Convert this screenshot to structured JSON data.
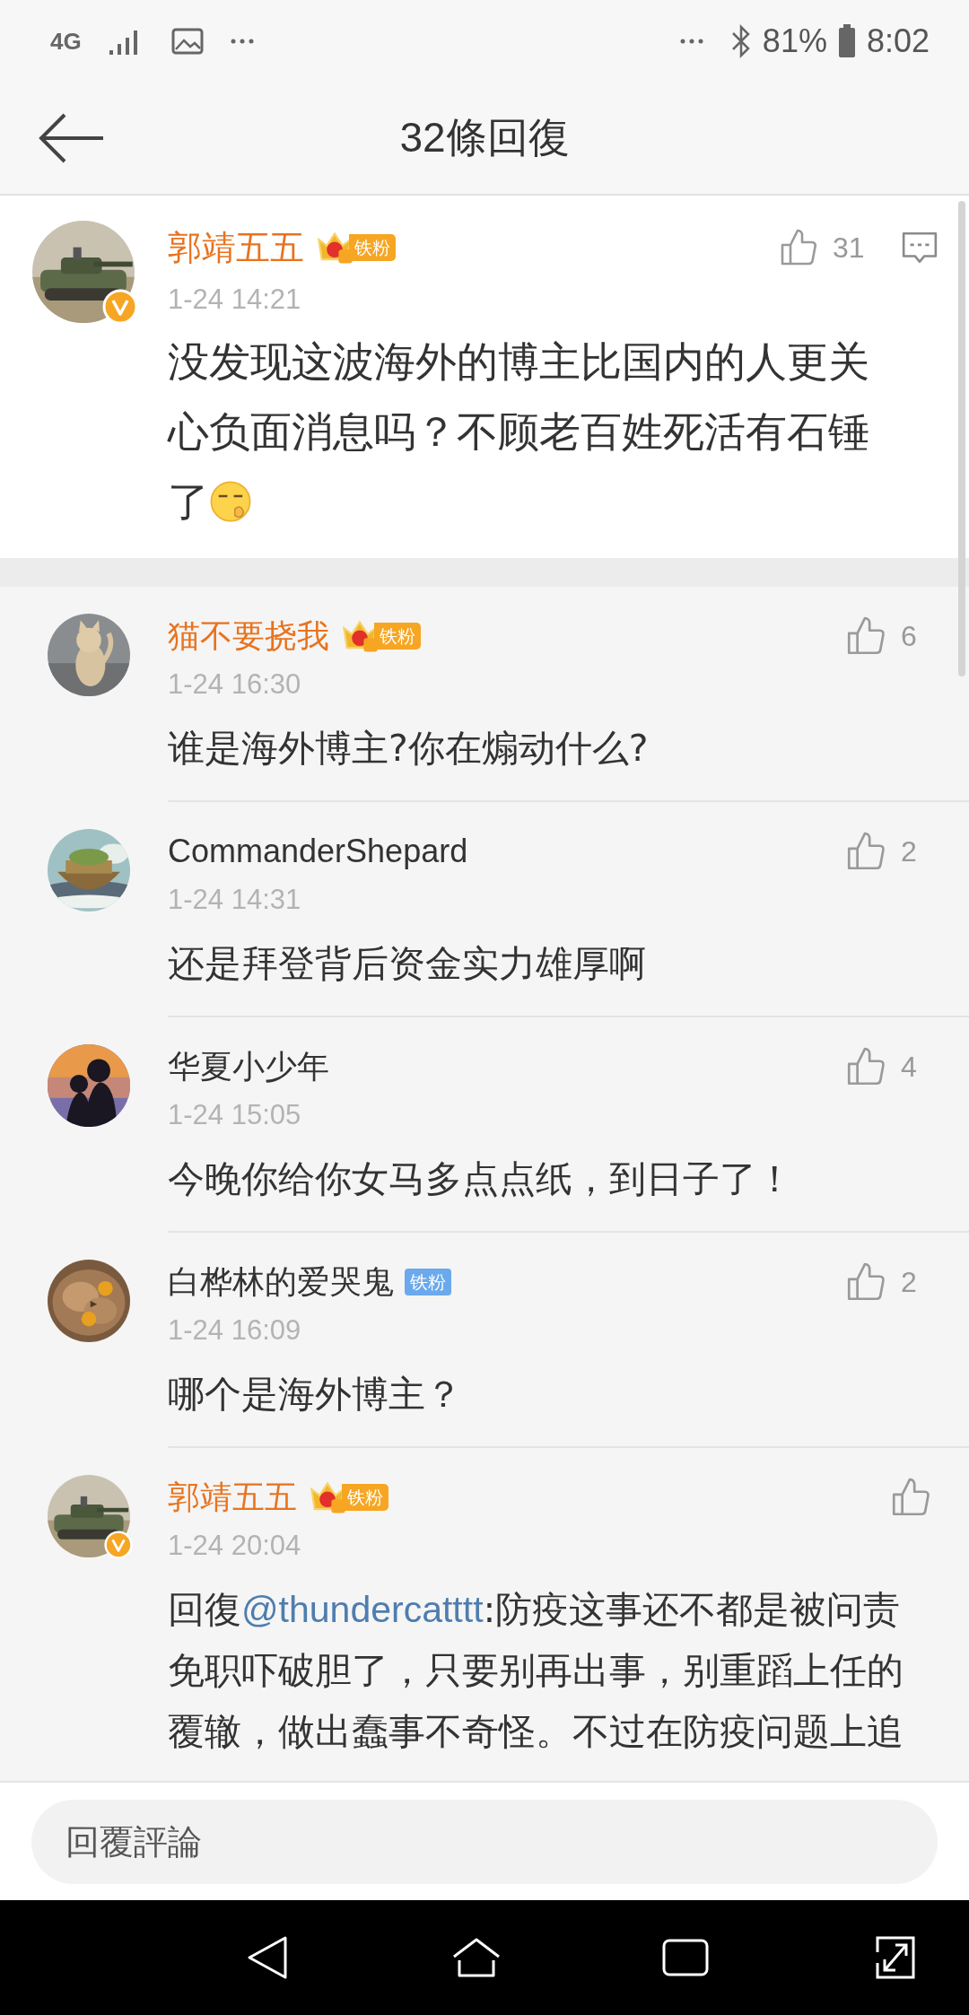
{
  "status_bar": {
    "network": "4G",
    "battery": "81%",
    "time": "8:02"
  },
  "header": {
    "title": "32條回復"
  },
  "comment": {
    "user": "郭靖五五",
    "vip": true,
    "verified": true,
    "badge": {
      "kind": "crown",
      "label": "铁粉"
    },
    "time": "1-24 14:21",
    "text": "没发现这波海外的博主比国内的人更关心负面消息吗？不顾老百姓死活有石锤了",
    "likes": "31"
  },
  "replies": [
    {
      "user": "猫不要挠我",
      "vip": true,
      "verified": false,
      "badge": {
        "kind": "crown",
        "label": "铁粉"
      },
      "time": "1-24 16:30",
      "text": "谁是海外博主?你在煽动什么?",
      "likes": "6"
    },
    {
      "user": "CommanderShepard",
      "vip": false,
      "verified": false,
      "time": "1-24 14:31",
      "text": "还是拜登背后资金实力雄厚啊",
      "likes": "2"
    },
    {
      "user": "华夏小少年",
      "vip": false,
      "verified": false,
      "time": "1-24 15:05",
      "text": "今晚你给你女马多点点纸，到日子了！",
      "likes": "4"
    },
    {
      "user": "白桦林的爱哭鬼",
      "vip": false,
      "verified": false,
      "badge": {
        "kind": "plain",
        "label": "铁粉"
      },
      "time": "1-24 16:09",
      "text": "哪个是海外博主？",
      "likes": "2"
    },
    {
      "user": "郭靖五五",
      "vip": true,
      "verified": true,
      "badge": {
        "kind": "crown",
        "label": "铁粉"
      },
      "time": "1-24 20:04",
      "prefix": "回復",
      "mention": "@thundercatttt",
      "text": ":防疫这事还不都是被问责免职吓破胆了，只要别再出事，别重蹈上任的覆辙，做出蠢事不奇怪。不过在防疫问题上追"
    }
  ],
  "composer": {
    "placeholder": "回覆評論"
  }
}
